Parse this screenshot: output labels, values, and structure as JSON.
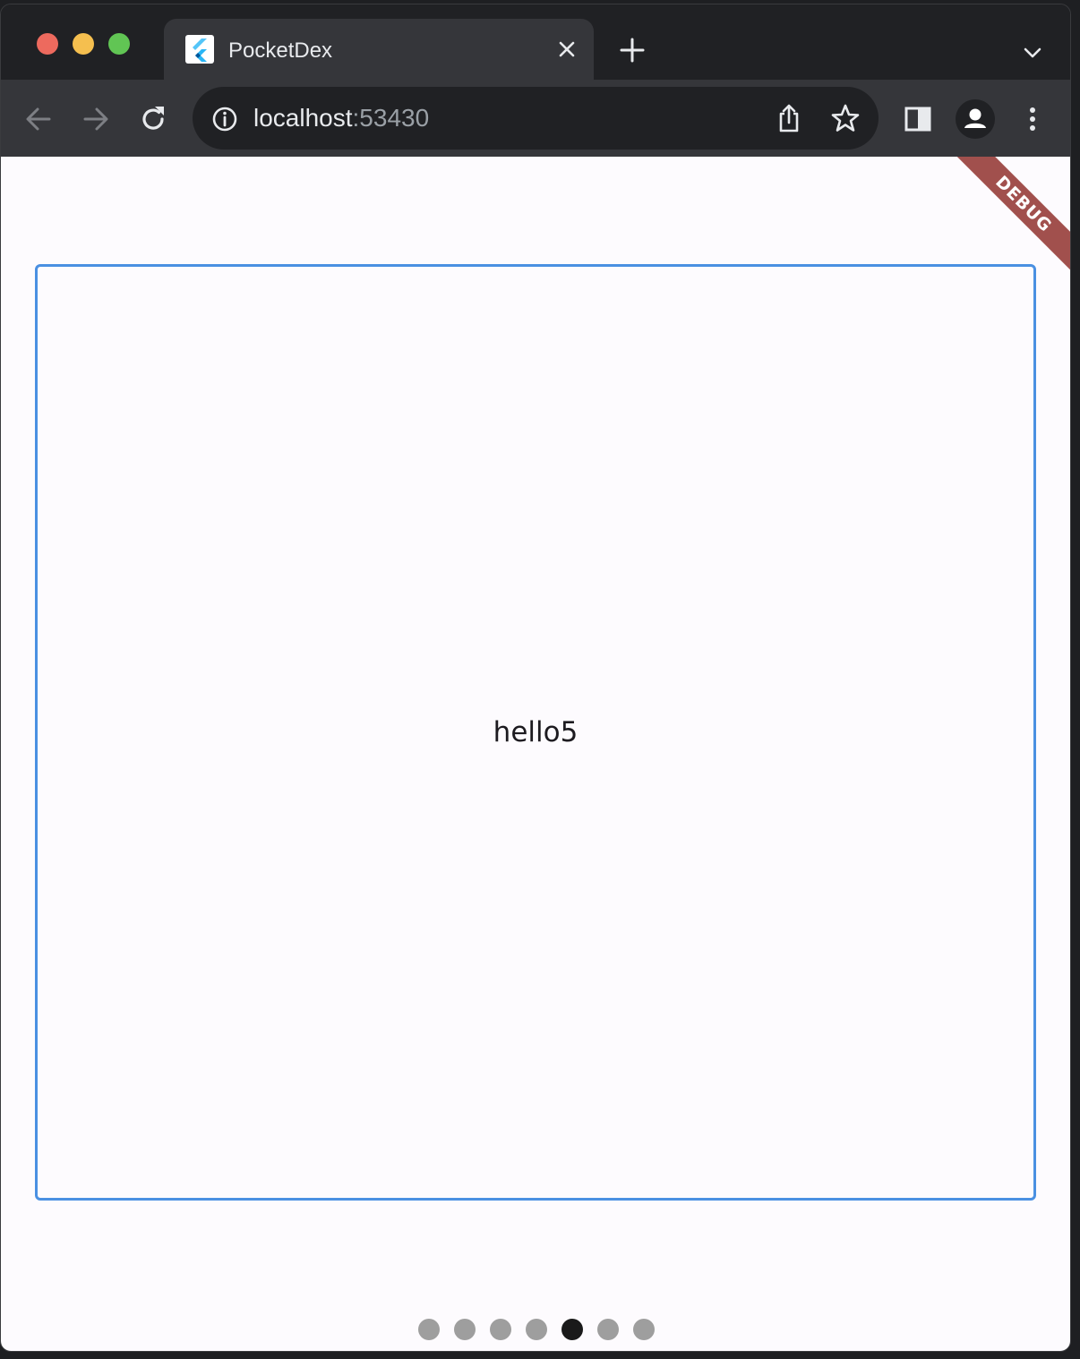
{
  "tab": {
    "title": "PocketDex",
    "close_label": "×"
  },
  "toolbar": {
    "url_host": "localhost",
    "url_port": ":53430"
  },
  "page": {
    "debug_banner": "DEBUG",
    "card_text": "hello5",
    "page_indicator": {
      "count": 7,
      "active_index": 4
    }
  },
  "colors": {
    "card_border": "#4a90e2",
    "dot_inactive": "#9e9e9e",
    "dot_active": "#1a1a1a",
    "debug_banner": "#a1504d"
  },
  "icons": {
    "back": "arrow-left-icon",
    "forward": "arrow-right-icon",
    "reload": "reload-icon",
    "info": "info-icon",
    "share": "share-icon",
    "star": "star-icon",
    "sidepanel": "side-panel-icon",
    "profile": "profile-icon",
    "menu": "kebab-menu-icon"
  }
}
